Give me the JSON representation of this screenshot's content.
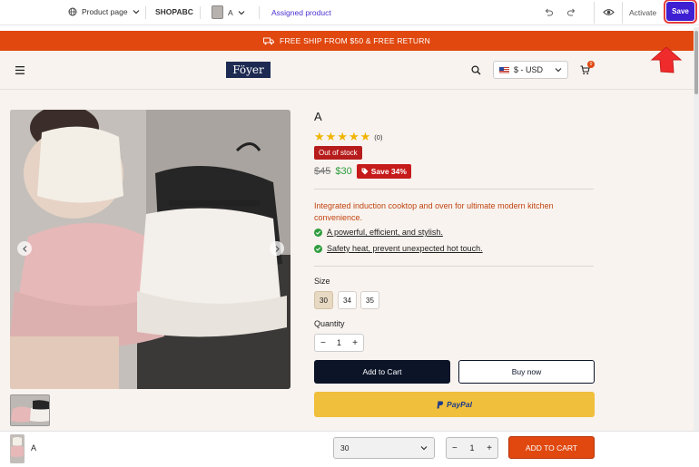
{
  "topbar": {
    "page_type_label": "Product page",
    "store_label": "SHOPABC",
    "product_label": "A",
    "assigned_label": "Assigned product",
    "activate_label": "Activate",
    "save_label": "Save"
  },
  "announcement": {
    "text": "FREE SHIP FROM $50 & FREE RETURN"
  },
  "store_header": {
    "logo_text": "Föyer",
    "currency_label": "$ - USD",
    "cart_count": "0"
  },
  "product": {
    "title": "A",
    "rating": 5,
    "review_count": "(0)",
    "stock_status": "Out of stock",
    "price_old": "$45",
    "price_new": "$30",
    "save_badge": "Save 34%",
    "description": "Integrated induction cooktop and oven for ultimate modern kitchen convenience.",
    "bullets": [
      "A powerful, efficient, and stylish.",
      "Safety heat, prevent unexpected hot touch."
    ],
    "size_label": "Size",
    "sizes": [
      "30",
      "34",
      "35"
    ],
    "selected_size": "30",
    "quantity_label": "Quantity",
    "quantity": "1",
    "add_to_cart_label": "Add to Cart",
    "buy_now_label": "Buy now",
    "paypal_label": "PayPal"
  },
  "sticky_bar": {
    "title": "A",
    "selected_option": "30",
    "quantity": "1",
    "add_to_cart_label": "ADD TO CART"
  },
  "colors": {
    "accent_orange": "#e0480f",
    "save_button": "#3f1fd2",
    "out_of_stock": "#b71c1c",
    "price_green": "#2e9d3e",
    "paypal_yellow": "#f0bf3b"
  }
}
